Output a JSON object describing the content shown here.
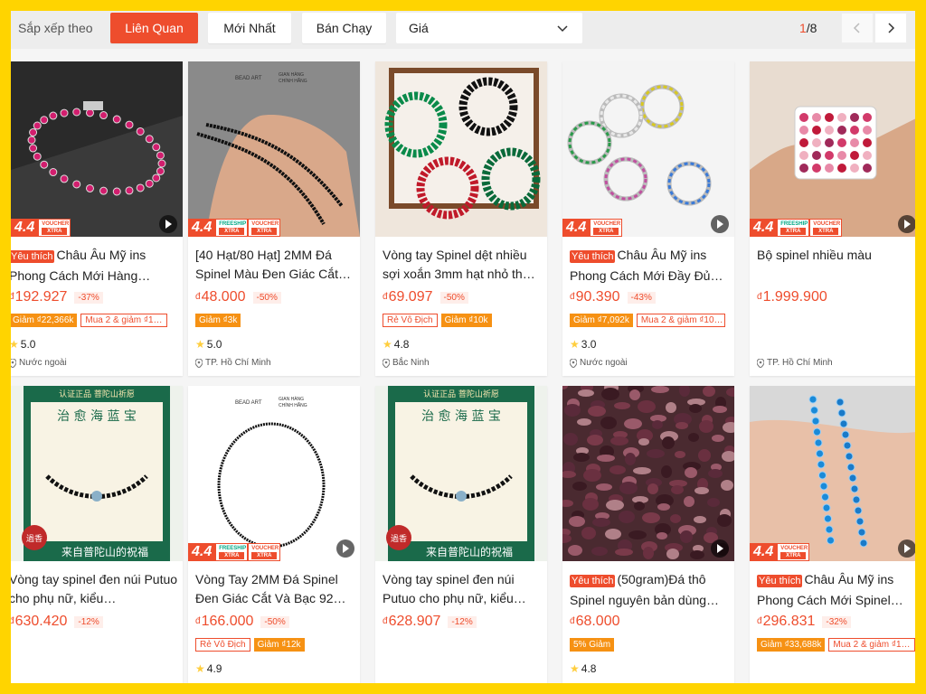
{
  "sortbar": {
    "label": "Sắp xếp theo",
    "options": [
      "Liên Quan",
      "Mới Nhất",
      "Bán Chạy"
    ],
    "active": "Liên Quan",
    "price_select": "Giá",
    "page_current": "1",
    "page_total": "/8"
  },
  "colors": {
    "brand": "#ee4d2d",
    "voucher": "#f69113",
    "star": "#ffce3d",
    "frame": "#ffd400"
  },
  "badges": {
    "sale": "4.4",
    "freeship_top": "FREESHIP",
    "freeship_bottom": "XTRA",
    "voucher_top": "VOUCHER",
    "voucher_bottom": "XTRA"
  },
  "products": [
    {
      "title": "Châu Âu Mỹ ins Phong Cách Mới Hàng…",
      "tag": "Yêu thích",
      "currency": "đ",
      "price": "192.927",
      "discount": "-37%",
      "chips": [
        {
          "t": "Giảm ₫22,366k",
          "fill": true
        },
        {
          "t": "Mua 2 & giảm ₫1…",
          "fill": false
        }
      ],
      "rating": "5.0",
      "location": "Nước ngoài",
      "badge": "44v",
      "play": true,
      "img": "bracelet-red"
    },
    {
      "title": "[40 Hạt/80 Hạt] 2MM Đá Spinel Màu Đen Giác Cắt…",
      "tag": "",
      "currency": "đ",
      "price": "48.000",
      "discount": "-50%",
      "chips": [
        {
          "t": "Giảm ₫3k",
          "fill": true
        }
      ],
      "rating": "5.0",
      "location": "TP. Hồ Chí Minh",
      "badge": "44fv",
      "play": false,
      "img": "hand-black"
    },
    {
      "title": "Vòng tay Spinel dệt nhiều sợi xoắn 3mm hạt nhỏ th…",
      "tag": "",
      "currency": "đ",
      "price": "69.097",
      "discount": "-50%",
      "chips": [
        {
          "t": "Rẻ Vô Địch",
          "fill": false
        },
        {
          "t": "Giảm ₫10k",
          "fill": true
        }
      ],
      "rating": "4.8",
      "location": "Bắc Ninh",
      "badge": "",
      "play": false,
      "img": "twisted"
    },
    {
      "title": "Châu Âu Mỹ ins Phong Cách Mới Đầy Đủ…",
      "tag": "Yêu thích",
      "currency": "đ",
      "price": "90.390",
      "discount": "-43%",
      "chips": [
        {
          "t": "Giảm ₫7,092k",
          "fill": true
        },
        {
          "t": "Mua 2 & giảm ₫10…",
          "fill": false
        }
      ],
      "rating": "3.0",
      "location": "Nước ngoài",
      "badge": "44v",
      "play": true,
      "img": "earrings"
    },
    {
      "title": "Bộ spinel nhiều màu",
      "tag": "",
      "currency": "đ",
      "price": "1.999.900",
      "discount": "",
      "chips": [],
      "rating": "",
      "location": "TP. Hồ Chí Minh",
      "badge": "44fv",
      "play": true,
      "img": "gembox"
    },
    {
      "title": "Vòng tay spinel đen núi Putuo cho phụ nữ, kiểu…",
      "tag": "",
      "currency": "đ",
      "price": "630.420",
      "discount": "-12%",
      "chips": [],
      "rating": "",
      "location": "",
      "badge": "",
      "play": false,
      "img": "poster"
    },
    {
      "title": "Vòng Tay 2MM Đá Spinel Đen Giác Cắt Và Bạc 92…",
      "tag": "",
      "currency": "đ",
      "price": "166.000",
      "discount": "-50%",
      "chips": [
        {
          "t": "Rẻ Vô Địch",
          "fill": false
        },
        {
          "t": "Giảm ₫12k",
          "fill": true
        }
      ],
      "rating": "4.9",
      "location": "",
      "badge": "44fv",
      "play": true,
      "img": "white-black"
    },
    {
      "title": "Vòng tay spinel đen núi Putuo cho phụ nữ, kiểu…",
      "tag": "",
      "currency": "đ",
      "price": "628.907",
      "discount": "-12%",
      "chips": [],
      "rating": "",
      "location": "",
      "badge": "",
      "play": false,
      "img": "poster"
    },
    {
      "title": "(50gram)Đá thô Spinel nguyên bản dùng…",
      "tag": "Yêu thích",
      "currency": "đ",
      "price": "68.000",
      "discount": "",
      "chips": [
        {
          "t": "5% Giảm",
          "fill": true
        }
      ],
      "rating": "4.8",
      "location": "",
      "badge": "",
      "play": true,
      "img": "raw"
    },
    {
      "title": "Châu Âu Mỹ ins Phong Cách Mới Spinel…",
      "tag": "Yêu thích",
      "currency": "đ",
      "price": "296.831",
      "discount": "-32%",
      "chips": [
        {
          "t": "Giảm ₫33,688k",
          "fill": true
        },
        {
          "t": "Mua 2 & giảm ₫1…",
          "fill": false
        }
      ],
      "rating": "",
      "location": "",
      "badge": "44v",
      "play": true,
      "img": "blue"
    }
  ],
  "image_text": {
    "bead_art": "BEAD ART",
    "store_line1": "GIAN HÀNG",
    "store_line2": "CHÍNH HÃNG",
    "poster_top": "认证正品 菩陀山祈愿",
    "poster_title": "治 愈 海 蓝 宝",
    "poster_bottom": "来自普陀山的祝福",
    "poster_stamp": "過香"
  }
}
